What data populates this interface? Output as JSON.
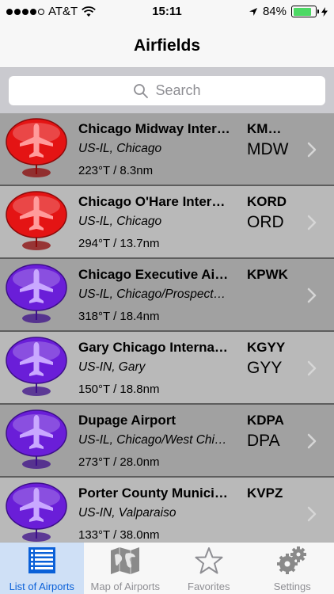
{
  "status_bar": {
    "carrier": "AT&T",
    "time": "15:11",
    "battery": "84%",
    "signal_bars": 4,
    "signal_total": 5,
    "battery_level": 0.84,
    "battery_color": "#4cd964"
  },
  "header": {
    "title": "Airfields"
  },
  "search": {
    "placeholder": "Search",
    "icon": "search-icon"
  },
  "airports": [
    {
      "name": "Chicago Midway Inter…",
      "region": "US-IL, Chicago",
      "bearing": "223°T / 8.3nm",
      "icao": "KM…",
      "iata": "MDW",
      "pin_color": "red"
    },
    {
      "name": "Chicago O'Hare Inter…",
      "region": "US-IL, Chicago",
      "bearing": "294°T / 13.7nm",
      "icao": "KORD",
      "iata": "ORD",
      "pin_color": "red"
    },
    {
      "name": "Chicago Executive Ai…",
      "region": "US-IL, Chicago/Prospect…",
      "bearing": "318°T / 18.4nm",
      "icao": "KPWK",
      "iata": "",
      "pin_color": "purple"
    },
    {
      "name": "Gary Chicago Interna…",
      "region": "US-IN, Gary",
      "bearing": "150°T / 18.8nm",
      "icao": "KGYY",
      "iata": "GYY",
      "pin_color": "purple"
    },
    {
      "name": "Dupage Airport",
      "region": "US-IL, Chicago/West Chi…",
      "bearing": "273°T / 28.0nm",
      "icao": "KDPA",
      "iata": "DPA",
      "pin_color": "purple"
    },
    {
      "name": "Porter County Munici…",
      "region": "US-IN, Valparaiso",
      "bearing": "133°T / 38.0nm",
      "icao": "KVPZ",
      "iata": "",
      "pin_color": "purple"
    }
  ],
  "tab_bar": {
    "tabs": [
      {
        "label": "List of Airports",
        "icon": "list-icon",
        "active": true
      },
      {
        "label": "Map of Airports",
        "icon": "map-icon",
        "active": false
      },
      {
        "label": "Favorites",
        "icon": "star-icon",
        "active": false
      },
      {
        "label": "Settings",
        "icon": "gears-icon",
        "active": false
      }
    ]
  },
  "colors": {
    "pin_red": "#e41414",
    "pin_purple": "#6a1ed8",
    "active_tab": "#0a60d8"
  }
}
